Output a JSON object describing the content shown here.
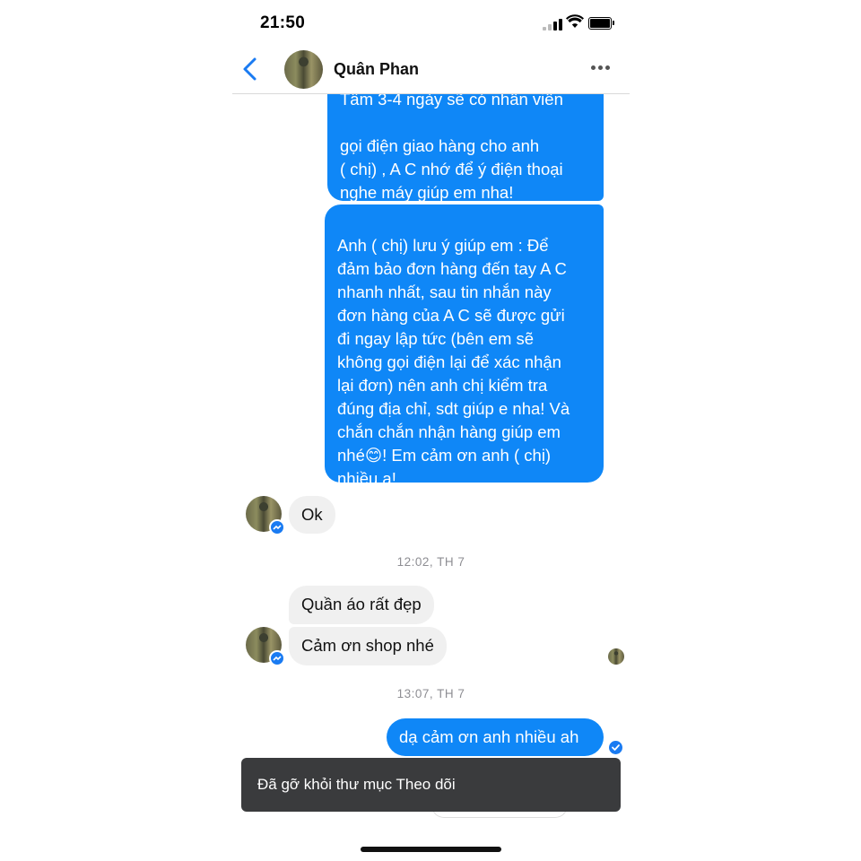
{
  "status_bar": {
    "time": "21:50"
  },
  "header": {
    "contact_name": "Quân Phan"
  },
  "messages": {
    "out_1": "gọi điện giao hàng cho anh\n( chị) , A C nhớ để ý điện thoại\nnghe máy giúp em nha!\nđã chốt (LINH)",
    "out_1_partial": "Tầm 3-4 ngày sẽ có nhân viên",
    "out_2": "Anh ( chị) lưu ý giúp em : Để\nđảm bảo đơn hàng đến tay A C\nnhanh nhất, sau tin nhắn này\nđơn hàng của A C sẽ được gửi\nđi ngay lập tức (bên em sẽ\nkhông gọi điện lại để xác nhận\nlại đơn) nên anh chị kiểm tra\nđúng địa chỉ, sdt giúp e nha! Và\nchắn chắn nhận hàng giúp em\nnhé😊! Em cảm ơn anh ( chị)\nnhiều ạ!",
    "in_ok": "Ok",
    "timestamp_1": "12:02, TH 7",
    "in_2": "Quần áo rất đẹp",
    "in_3": "Cảm ơn shop nhé",
    "timestamp_2": "13:07, TH 7",
    "out_3": "dạ cảm ơn anh nhiều ah"
  },
  "toast": {
    "text": "Đã gỡ khỏi thư mục Theo dõi"
  },
  "colors": {
    "accent": "#0f87f7",
    "incoming_bubble": "#f0f0f0",
    "toast_bg": "#3a3b3d"
  },
  "icons": [
    "back-chevron-icon",
    "more-dots-icon",
    "messenger-badge-icon",
    "sent-check-icon",
    "signal-icon",
    "wifi-icon",
    "battery-icon"
  ]
}
